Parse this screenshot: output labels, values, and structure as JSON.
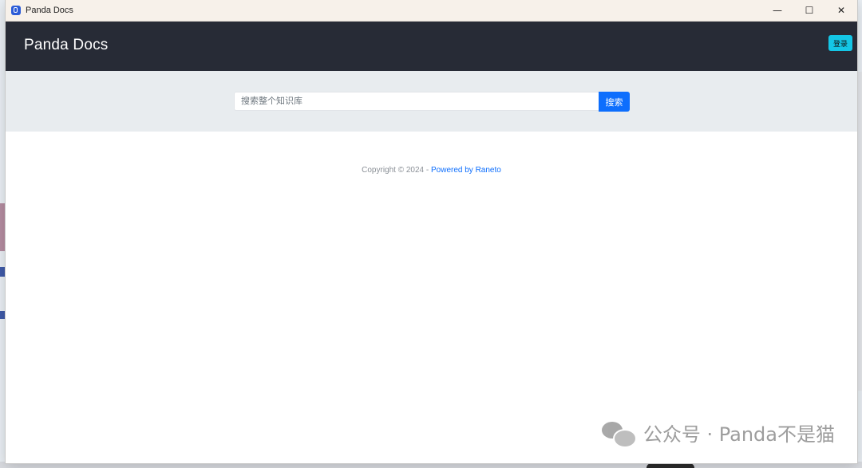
{
  "window": {
    "title": "Panda Docs",
    "controls": {
      "minimize": "—",
      "maximize": "☐",
      "close": "✕"
    }
  },
  "navbar": {
    "brand": "Panda Docs",
    "login_label": "登录"
  },
  "search": {
    "placeholder": "搜索整个知识库",
    "button_label": "搜索"
  },
  "footer": {
    "copyright": "Copyright © 2024 - ",
    "powered_link": "Powered by Raneto"
  },
  "watermark": {
    "text": "公众号 · Panda不是猫"
  },
  "colors": {
    "navbar_bg": "#272b36",
    "search_band_bg": "#e8ecef",
    "primary": "#0d6efd",
    "login_button": "#14c6e6"
  }
}
